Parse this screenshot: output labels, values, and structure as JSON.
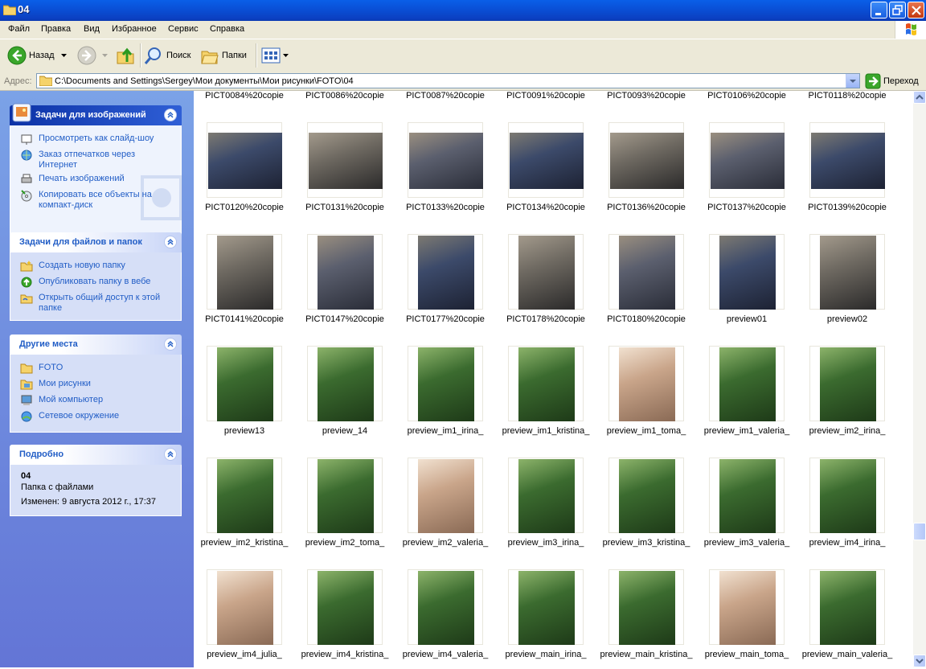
{
  "window": {
    "title": "04"
  },
  "menu": [
    "Файл",
    "Правка",
    "Вид",
    "Избранное",
    "Сервис",
    "Справка"
  ],
  "toolbar": {
    "back": "Назад",
    "search": "Поиск",
    "folders": "Папки"
  },
  "address": {
    "label": "Адрес:",
    "path": "C:\\Documents and Settings\\Sergey\\Мои документы\\Мои рисунки\\FOTO\\04",
    "go": "Переход"
  },
  "panels": {
    "image_tasks": {
      "title": "Задачи для изображений",
      "items": [
        "Просмотреть как слайд-шоу",
        "Заказ отпечатков через Интернет",
        "Печать изображений",
        "Копировать все объекты на компакт-диск"
      ]
    },
    "file_tasks": {
      "title": "Задачи для файлов и папок",
      "items": [
        "Создать новую папку",
        "Опубликовать папку в вебе",
        "Открыть общий доступ к этой папке"
      ]
    },
    "other_places": {
      "title": "Другие места",
      "items": [
        "FOTO",
        "Мои рисунки",
        "Мой компьютер",
        "Сетевое окружение"
      ]
    },
    "details": {
      "title": "Подробно",
      "name": "04",
      "type": "Папка с файлами",
      "modified": "Изменен: 9 августа 2012 г., 17:37"
    }
  },
  "files": [
    "PICT0084%20copie",
    "PICT0086%20copie",
    "PICT0087%20copie",
    "PICT0091%20copie",
    "PICT0093%20copie",
    "PICT0106%20copie",
    "PICT0118%20copie",
    "PICT0120%20copie",
    "PICT0131%20copie",
    "PICT0133%20copie",
    "PICT0134%20copie",
    "PICT0136%20copie",
    "PICT0137%20copie",
    "PICT0139%20copie",
    "PICT0141%20copie",
    "PICT0147%20copie",
    "PICT0177%20copie",
    "PICT0178%20copie",
    "PICT0180%20copie",
    "preview01",
    "preview02",
    "preview13",
    "preview_14",
    "preview_im1_irina_",
    "preview_im1_kristina_",
    "preview_im1_toma_",
    "preview_im1_valeria_",
    "preview_im2_irina_",
    "preview_im2_kristina_",
    "preview_im2_toma_",
    "preview_im2_valeria_",
    "preview_im3_irina_",
    "preview_im3_kristina_",
    "preview_im3_valeria_",
    "preview_im4_irina_",
    "preview_im4_julia_",
    "preview_im4_kristina_",
    "preview_im4_valeria_",
    "preview_main_irina_",
    "preview_main_kristina_",
    "preview_main_toma_",
    "preview_main_valeria_"
  ],
  "icons": {
    "folder": "folder-icon",
    "back": "back-arrow-icon",
    "forward": "forward-arrow-icon",
    "up": "up-folder-icon",
    "search": "search-icon",
    "folders": "folders-icon",
    "views": "views-icon",
    "go": "go-arrow-icon"
  }
}
